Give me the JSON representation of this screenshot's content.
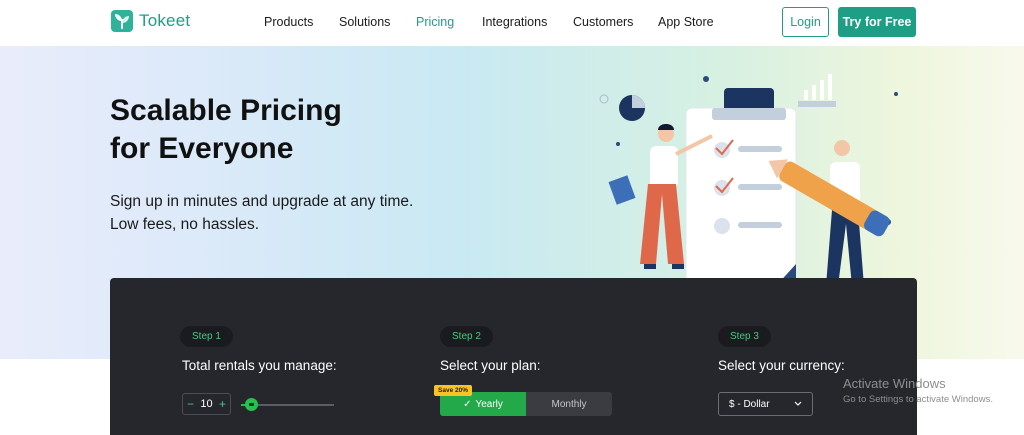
{
  "header": {
    "logo_text": "Tokeet",
    "nav": [
      "Products",
      "Solutions",
      "Pricing",
      "Integrations",
      "Customers",
      "App Store"
    ],
    "active_nav": "Pricing",
    "login_label": "Login",
    "try_label": "Try for Free"
  },
  "hero": {
    "title_line1": "Scalable Pricing",
    "title_line2": "for Everyone",
    "sub_line1": "Sign up in minutes and upgrade at any time.",
    "sub_line2": "Low fees, no hassles."
  },
  "pricing": {
    "step1": {
      "badge": "Step 1",
      "title": "Total rentals you manage:",
      "value": "10",
      "minus": "−",
      "plus": "+"
    },
    "step2": {
      "badge": "Step 2",
      "title": "Select your plan:",
      "save_badge": "Save 20%",
      "yearly": "Yearly",
      "monthly": "Monthly",
      "selected": "Yearly"
    },
    "step3": {
      "badge": "Step 3",
      "title": "Select your currency:",
      "currency": "$ - Dollar"
    }
  },
  "watermark": {
    "title": "Activate Windows",
    "subtitle": "Go to Settings to activate Windows."
  },
  "colors": {
    "brand": "#1f9e86",
    "card": "#25272c",
    "accent_green": "#23a94a",
    "badge_yellow": "#f7c325"
  }
}
